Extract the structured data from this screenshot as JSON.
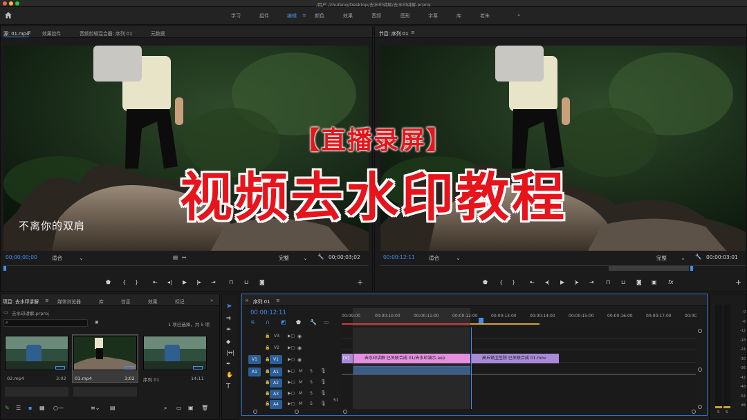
{
  "window": {
    "title": "/用户 /zhufeng/Desktop/去水印讲解/去水印讲解.prproj"
  },
  "workspaces": [
    "学习",
    "组件",
    "编辑",
    "颜色",
    "效果",
    "音频",
    "图形",
    "字幕",
    "库",
    "老朱",
    "»"
  ],
  "active_workspace": "编辑",
  "source_panel": {
    "tabs": [
      "源: 01.mp4",
      "效果控件",
      "音频剪辑混合器: 序列 01",
      "元数据"
    ],
    "timecode_in": "00;00;00;00",
    "fit": "适合",
    "quality": "完整",
    "timecode_out": "00;00;03;02",
    "caption": "不离你的双肩"
  },
  "program_panel": {
    "tabs": [
      "节目: 序列 01"
    ],
    "timecode_in": "00:00:12:11",
    "fit": "适合",
    "quality": "完整",
    "timecode_out": "00:00:03:01"
  },
  "overlay": {
    "line1": "【直播录屏】",
    "line2": "视频去水印教程"
  },
  "project_panel": {
    "tabs": [
      "项目: 去水印讲解",
      "媒体浏览器",
      "库",
      "信息",
      "效果",
      "标记",
      "»"
    ],
    "file": "去水印讲解.prproj",
    "selection": "1 项已选择，共 5 项",
    "items": [
      {
        "name": "02.mp4",
        "duration": "3;02"
      },
      {
        "name": "01.mp4",
        "duration": "3;02"
      },
      {
        "name": "序列 01",
        "duration": "14:11"
      }
    ]
  },
  "timeline": {
    "tab": "序列 01",
    "timecode": "00:00:12:11",
    "ruler": [
      "00:09:00",
      "00:00:10:00",
      "00:00:11:00",
      "00:00:12:00",
      "00:00:13:00",
      "00:00:14:00",
      "00:00:15:00",
      "00:00:16:00",
      "00:00:17:00",
      "00:0C"
    ],
    "video_tracks": [
      "V3",
      "V2",
      "V1"
    ],
    "audio_tracks": [
      "A1",
      "A2",
      "A3",
      "A4"
    ],
    "clips": [
      {
        "label": "[V]"
      },
      {
        "label": "去水印讲解 已关联合成 01/去水印演示.aep"
      },
      {
        "label": "高丘镇卫生院 已关联合成 01.mov"
      }
    ],
    "target_labels": {
      "v1": "V1",
      "a1": "A1",
      "m": "M",
      "s": "S",
      "sync": "S1"
    }
  },
  "meter": {
    "scale": [
      "0",
      "-6",
      "-12",
      "-18",
      "-24",
      "-30",
      "-36",
      "-42",
      "-48",
      "-54",
      "dB"
    ],
    "channels": [
      "S",
      "S"
    ]
  },
  "colors": {
    "accent": "#3f8ff0",
    "clip_pink": "#e48fe0",
    "clip_purple": "#a88ad8",
    "overlay_red": "#e8141b"
  }
}
